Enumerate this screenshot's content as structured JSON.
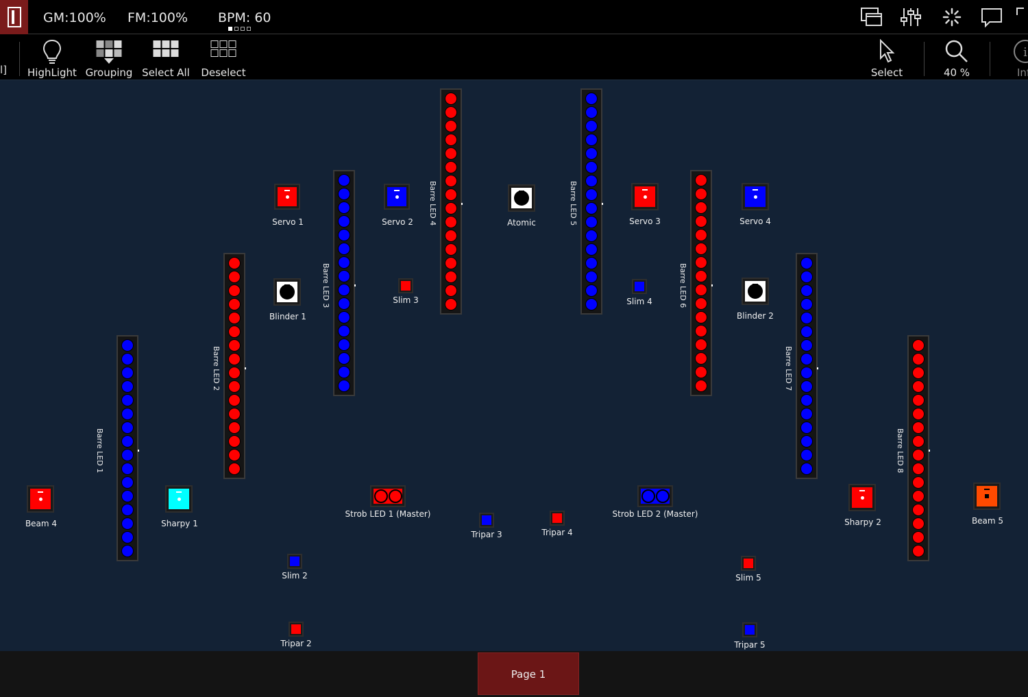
{
  "status": {
    "gm": "GM:100%",
    "fm": "FM:100%",
    "bpm": "BPM: 60"
  },
  "toolbar": {
    "left_cut": "l]",
    "highlight": "HighLight",
    "grouping": "Grouping",
    "select_all": "Select All",
    "deselect": "Deselect",
    "select": "Select",
    "zoom": "40 %",
    "info_cut": "Inf"
  },
  "colors": {
    "red": "#ff0000",
    "blue": "#0000ff",
    "cyan": "#00ffff",
    "orange": "#ff4a00",
    "white": "#ffffff",
    "stage_bg": "#132235",
    "page_tab": "#6b1616"
  },
  "fixtures": {
    "servo1": "Servo 1",
    "servo2": "Servo 2",
    "atomic": "Atomic",
    "servo3": "Servo 3",
    "servo4": "Servo 4",
    "blinder1": "Blinder 1",
    "blinder2": "Blinder 2",
    "slim3": "Slim 3",
    "slim4": "Slim 4",
    "beam4": "Beam 4",
    "sharpy1": "Sharpy 1",
    "strob1": "Strob LED 1 (Master)",
    "strob2": "Strob LED 2 (Master)",
    "tripar3": "Tripar 3",
    "tripar4": "Tripar 4",
    "sharpy2": "Sharpy 2",
    "beam5": "Beam 5",
    "slim2": "Slim 2",
    "slim5": "Slim 5",
    "tripar2": "Tripar 2",
    "tripar5": "Tripar 5"
  },
  "bars": {
    "b1": "Barre LED 1",
    "b2": "Barre LED 2",
    "b3": "Barre LED 3",
    "b4": "Barre LED 4",
    "b5": "Barre LED 5",
    "b6": "Barre LED 6",
    "b7": "Barre LED 7",
    "b8": "Barre LED 8"
  },
  "pagebar": {
    "page": "Page 1"
  }
}
